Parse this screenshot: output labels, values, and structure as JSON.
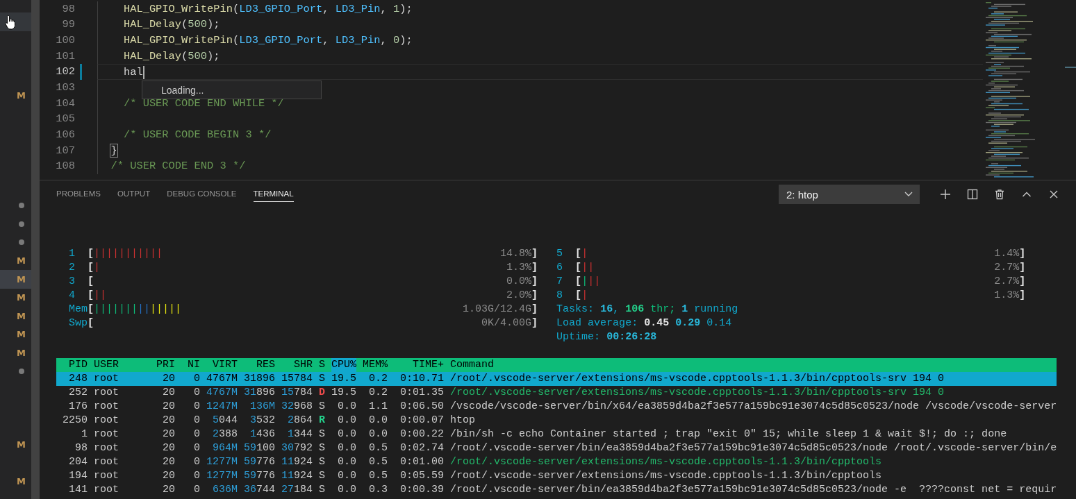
{
  "explorer": {
    "rows": [
      {
        "highlighted": true
      },
      {
        "highlighted": false
      },
      {
        "highlighted": false
      },
      {
        "highlighted": false
      },
      {
        "highlighted": false,
        "badge": {
          "kind": "letter",
          "text": "M"
        }
      },
      {
        "highlighted": false
      },
      {
        "highlighted": false
      },
      {
        "highlighted": false
      },
      {
        "highlighted": false
      },
      {
        "highlighted": false
      },
      {
        "highlighted": false,
        "badge": {
          "kind": "dot"
        }
      },
      {
        "highlighted": false,
        "badge": {
          "kind": "dot"
        }
      },
      {
        "highlighted": false,
        "badge": {
          "kind": "dot"
        }
      },
      {
        "highlighted": false,
        "badge": {
          "kind": "letter",
          "text": "M"
        }
      },
      {
        "highlighted": true,
        "badge": {
          "kind": "letter",
          "text": "M"
        }
      },
      {
        "highlighted": false,
        "badge": {
          "kind": "letter",
          "text": "M"
        }
      },
      {
        "highlighted": false,
        "badge": {
          "kind": "letter",
          "text": "M"
        }
      },
      {
        "highlighted": false,
        "badge": {
          "kind": "letter",
          "text": "M"
        }
      },
      {
        "highlighted": false,
        "badge": {
          "kind": "letter",
          "text": "M"
        }
      },
      {
        "highlighted": false,
        "badge": {
          "kind": "dot"
        }
      },
      {
        "highlighted": false
      },
      {
        "highlighted": false
      },
      {
        "highlighted": false
      },
      {
        "highlighted": false,
        "badge": {
          "kind": "letter",
          "text": "M"
        }
      },
      {
        "highlighted": false
      },
      {
        "highlighted": false,
        "badge": {
          "kind": "letter",
          "text": "M"
        }
      }
    ]
  },
  "editor": {
    "lines": [
      {
        "number": "98",
        "current": false,
        "modified": false,
        "tokens": [
          {
            "kind": "fn",
            "text": "    HAL_GPIO_WritePin"
          },
          {
            "kind": "punct",
            "text": "("
          },
          {
            "kind": "var",
            "text": "LD3_GPIO_Port"
          },
          {
            "kind": "punct",
            "text": ", "
          },
          {
            "kind": "var",
            "text": "LD3_Pin"
          },
          {
            "kind": "punct",
            "text": ", "
          },
          {
            "kind": "num",
            "text": "1"
          },
          {
            "kind": "punct",
            "text": ");"
          }
        ]
      },
      {
        "number": "99",
        "current": false,
        "modified": false,
        "tokens": [
          {
            "kind": "fn",
            "text": "    HAL_Delay"
          },
          {
            "kind": "punct",
            "text": "("
          },
          {
            "kind": "num",
            "text": "500"
          },
          {
            "kind": "punct",
            "text": ");"
          }
        ]
      },
      {
        "number": "100",
        "current": false,
        "modified": false,
        "tokens": [
          {
            "kind": "fn",
            "text": "    HAL_GPIO_WritePin"
          },
          {
            "kind": "punct",
            "text": "("
          },
          {
            "kind": "var",
            "text": "LD3_GPIO_Port"
          },
          {
            "kind": "punct",
            "text": ", "
          },
          {
            "kind": "var",
            "text": "LD3_Pin"
          },
          {
            "kind": "punct",
            "text": ", "
          },
          {
            "kind": "num",
            "text": "0"
          },
          {
            "kind": "punct",
            "text": ");"
          }
        ]
      },
      {
        "number": "101",
        "current": false,
        "modified": false,
        "tokens": [
          {
            "kind": "fn",
            "text": "    HAL_Delay"
          },
          {
            "kind": "punct",
            "text": "("
          },
          {
            "kind": "num",
            "text": "500"
          },
          {
            "kind": "punct",
            "text": ");"
          }
        ]
      },
      {
        "number": "102",
        "current": true,
        "modified": true,
        "tokens": [
          {
            "kind": "plain",
            "text": "    hal"
          }
        ]
      },
      {
        "number": "103",
        "current": false,
        "modified": false
      },
      {
        "number": "104",
        "current": false,
        "modified": false,
        "tokens": [
          {
            "kind": "comment",
            "text": "    /* USER CODE END WHILE */"
          }
        ]
      },
      {
        "number": "105",
        "current": false,
        "modified": false
      },
      {
        "number": "106",
        "current": false,
        "modified": false,
        "tokens": [
          {
            "kind": "comment",
            "text": "    /* USER CODE BEGIN 3 */"
          }
        ]
      },
      {
        "number": "107",
        "current": false,
        "modified": false,
        "tokens": [
          {
            "kind": "bracket",
            "text": "}"
          }
        ]
      },
      {
        "number": "108",
        "current": false,
        "modified": false,
        "tokens": [
          {
            "kind": "comment",
            "text": "  /* USER CODE END 3 */"
          }
        ]
      }
    ],
    "suggest": {
      "text": "Loading..."
    }
  },
  "panel": {
    "tabs": [
      {
        "label": "PROBLEMS",
        "selected": false
      },
      {
        "label": "OUTPUT",
        "selected": false
      },
      {
        "label": "DEBUG CONSOLE",
        "selected": false
      },
      {
        "label": "TERMINAL",
        "selected": true
      }
    ],
    "terminal_select": "2: htop"
  },
  "htop": {
    "left_meters": [
      {
        "label": "1",
        "open": "[",
        "bars": [
          {
            "kind": "kernel",
            "text": "|||||||||||"
          }
        ],
        "value": "14.8%",
        "close": "]"
      },
      {
        "label": "2",
        "open": "[",
        "bars": [
          {
            "kind": "kernel",
            "text": "|"
          }
        ],
        "value": "1.3%",
        "close": "]"
      },
      {
        "label": "3",
        "open": "[",
        "value": "0.0%",
        "close": "]"
      },
      {
        "label": "4",
        "open": "[",
        "bars": [
          {
            "kind": "kernel",
            "text": "||"
          }
        ],
        "value": "2.0%",
        "close": "]"
      },
      {
        "label": "Mem",
        "open": "[",
        "bars": [
          {
            "kind": "user",
            "text": "|||||||"
          },
          {
            "kind": "buffers",
            "text": "||"
          },
          {
            "kind": "cache",
            "text": "|||||"
          }
        ],
        "value": "1.03G/12.4G",
        "close": "]"
      },
      {
        "label": "Swp",
        "open": "[",
        "value": "0K/4.00G",
        "close": "]"
      }
    ],
    "right_meters": [
      {
        "label": "5",
        "open": "[",
        "bars": [
          {
            "kind": "kernel",
            "text": "|"
          }
        ],
        "value": "1.4%",
        "close": "]"
      },
      {
        "label": "6",
        "open": "[",
        "bars": [
          {
            "kind": "kernel",
            "text": "||"
          }
        ],
        "value": "2.7%",
        "close": "]"
      },
      {
        "label": "7",
        "open": "[",
        "bars": [
          {
            "kind": "user",
            "text": "|"
          },
          {
            "kind": "kernel",
            "text": "||"
          }
        ],
        "value": "2.7%",
        "close": "]"
      },
      {
        "label": "8",
        "open": "[",
        "bars": [
          {
            "kind": "kernel",
            "text": "|"
          }
        ],
        "value": "1.3%",
        "close": "]"
      }
    ],
    "summary": [
      [
        {
          "kind": "text",
          "text": "Tasks: "
        },
        {
          "kind": "strong",
          "text": "16"
        },
        {
          "kind": "text",
          "text": ", "
        },
        {
          "kind": "thr_count",
          "text": "106"
        },
        {
          "kind": "thr_label",
          "text": " thr; "
        },
        {
          "kind": "strong",
          "text": "1"
        },
        {
          "kind": "text",
          "text": " running"
        }
      ],
      [
        {
          "kind": "text",
          "text": "Load average: "
        },
        {
          "kind": "load1",
          "text": "0.45 "
        },
        {
          "kind": "strong",
          "text": "0.29 "
        },
        {
          "kind": "text",
          "text": "0.14"
        }
      ],
      [
        {
          "kind": "text",
          "text": "Uptime: "
        },
        {
          "kind": "strong",
          "text": "00:26:28"
        }
      ]
    ],
    "columns": [
      {
        "label": "PID",
        "sorted": false
      },
      {
        "label": "USER",
        "sorted": false
      },
      {
        "label": "PRI",
        "sorted": false
      },
      {
        "label": "NI",
        "sorted": false
      },
      {
        "label": "VIRT",
        "sorted": false
      },
      {
        "label": "RES",
        "sorted": false
      },
      {
        "label": "SHR",
        "sorted": false
      },
      {
        "label": "S",
        "sorted": false
      },
      {
        "label": "CPU%",
        "sorted": true
      },
      {
        "label": "MEM%",
        "sorted": false
      },
      {
        "label": "TIME+",
        "sorted": false
      },
      {
        "label": "Command",
        "sorted": false
      }
    ],
    "processes": [
      {
        "selected": true,
        "thread": false,
        "pid": "248",
        "user": "root",
        "pri": "20",
        "ni": "0",
        "virt": {
          "tail": "4767M"
        },
        "res": {
          "tail": "31896"
        },
        "shr": {
          "tail": "15784"
        },
        "state": {
          "text": "S"
        },
        "cpu": "19.5",
        "mem": "0.2",
        "time": "0:10.71",
        "command": "/root/.vscode-server/extensions/ms-vscode.cpptools-1.1.3/bin/cpptools-srv 194 0"
      },
      {
        "selected": false,
        "thread": true,
        "pid": "252",
        "user": "root",
        "pri": "20",
        "ni": "0",
        "virt": {
          "lead": "4767M"
        },
        "res": {
          "lead": "31",
          "tail": "896"
        },
        "shr": {
          "lead": "15",
          "tail": "784"
        },
        "state": {
          "text": "D",
          "color": "#f14c4c"
        },
        "cpu": "19.5",
        "mem": "0.2",
        "time": "0:01.35",
        "command": "/root/.vscode-server/extensions/ms-vscode.cpptools-1.1.3/bin/cpptools-srv 194 0"
      },
      {
        "selected": false,
        "thread": false,
        "pid": "176",
        "user": "root",
        "pri": "20",
        "ni": "0",
        "virt": {
          "lead": "1247M"
        },
        "res": {
          "lead": "136M"
        },
        "shr": {
          "lead": "32",
          "tail": "968"
        },
        "state": {
          "text": "S"
        },
        "cpu": "0.0",
        "mem": "1.1",
        "time": "0:06.50",
        "command": "/vscode/vscode-server/bin/x64/ea3859d4ba2f3e577a159bc91e3074c5d85c0523/node /vscode/vscode-server"
      },
      {
        "selected": false,
        "thread": false,
        "pid": "2250",
        "user": "root",
        "pri": "20",
        "ni": "0",
        "virt": {
          "lead": "5",
          "tail": "044"
        },
        "res": {
          "lead": "3",
          "tail": "532"
        },
        "shr": {
          "lead": "2",
          "tail": "864"
        },
        "state": {
          "text": "R",
          "color": "#23d18b"
        },
        "cpu": "0.0",
        "mem": "0.0",
        "time": "0:00.07",
        "command": "htop"
      },
      {
        "selected": false,
        "thread": false,
        "pid": "1",
        "user": "root",
        "pri": "20",
        "ni": "0",
        "virt": {
          "lead": "2",
          "tail": "388"
        },
        "res": {
          "lead": "1",
          "tail": "436"
        },
        "shr": {
          "lead": "1",
          "tail": "344"
        },
        "state": {
          "text": "S"
        },
        "cpu": "0.0",
        "mem": "0.0",
        "time": "0:00.22",
        "command": "/bin/sh -c echo Container started ; trap \"exit 0\" 15; while sleep 1 & wait $!; do :; done"
      },
      {
        "selected": false,
        "thread": false,
        "pid": "98",
        "user": "root",
        "pri": "20",
        "ni": "0",
        "virt": {
          "lead": "964M"
        },
        "res": {
          "lead": "59",
          "tail": "100"
        },
        "shr": {
          "lead": "30",
          "tail": "792"
        },
        "state": {
          "text": "S"
        },
        "cpu": "0.0",
        "mem": "0.5",
        "time": "0:02.74",
        "command": "/root/.vscode-server/bin/ea3859d4ba2f3e577a159bc91e3074c5d85c0523/node /root/.vscode-server/bin/e"
      },
      {
        "selected": false,
        "thread": true,
        "pid": "204",
        "user": "root",
        "pri": "20",
        "ni": "0",
        "virt": {
          "lead": "1277M"
        },
        "res": {
          "lead": "59",
          "tail": "776"
        },
        "shr": {
          "lead": "11",
          "tail": "924"
        },
        "state": {
          "text": "S"
        },
        "cpu": "0.0",
        "mem": "0.5",
        "time": "0:01.00",
        "command": "/root/.vscode-server/extensions/ms-vscode.cpptools-1.1.3/bin/cpptools"
      },
      {
        "selected": false,
        "thread": false,
        "pid": "194",
        "user": "root",
        "pri": "20",
        "ni": "0",
        "virt": {
          "lead": "1277M"
        },
        "res": {
          "lead": "59",
          "tail": "776"
        },
        "shr": {
          "lead": "11",
          "tail": "924"
        },
        "state": {
          "text": "S"
        },
        "cpu": "0.0",
        "mem": "0.5",
        "time": "0:05.59",
        "command": "/root/.vscode-server/extensions/ms-vscode.cpptools-1.1.3/bin/cpptools"
      },
      {
        "selected": false,
        "thread": false,
        "pid": "141",
        "user": "root",
        "pri": "20",
        "ni": "0",
        "virt": {
          "lead": "636M"
        },
        "res": {
          "lead": "36",
          "tail": "744"
        },
        "shr": {
          "lead": "27",
          "tail": "184"
        },
        "state": {
          "text": "S"
        },
        "cpu": "0.0",
        "mem": "0.3",
        "time": "0:00.39",
        "command": "/root/.vscode-server/bin/ea3859d4ba2f3e577a159bc91e3074c5d85c0523/node -e  ????const net = requir"
      }
    ]
  }
}
